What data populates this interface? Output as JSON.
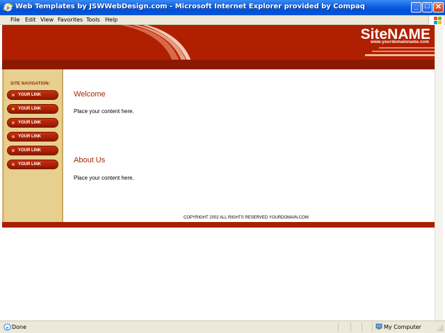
{
  "window": {
    "title": "Web Templates by JSWWebDesign.com - Microsoft Internet Explorer provided by Compaq",
    "controls": {
      "minimize": "_",
      "maximize": "□",
      "close": "✕"
    }
  },
  "menu": {
    "items": [
      "File",
      "Edit",
      "View",
      "Favorites",
      "Tools",
      "Help"
    ]
  },
  "site": {
    "name": "SiteNAME",
    "domain": "www.yourdomainname.com",
    "nav_heading": "SITE NAVIGATION:",
    "nav_links": [
      "YOUR LINK",
      "YOUR LINK",
      "YOUR LINK",
      "YOUR LINK",
      "YOUR LINK",
      "YOUR LINK"
    ],
    "sections": [
      {
        "title": "Welcome",
        "body": "Place your content here."
      },
      {
        "title": "About Us",
        "body": "Place your content here."
      }
    ],
    "copyright": "COPYRIGHT 2002 ALL RIGHTS RESERVED YOURDOMAIN.COM"
  },
  "status": {
    "text": "Done",
    "zone": "My Computer"
  },
  "colors": {
    "header_red": "#b02000",
    "sidebar_tan": "#e6cf8f",
    "accent_text": "#a82400",
    "titlebar_blue": "#0a5fe0"
  }
}
